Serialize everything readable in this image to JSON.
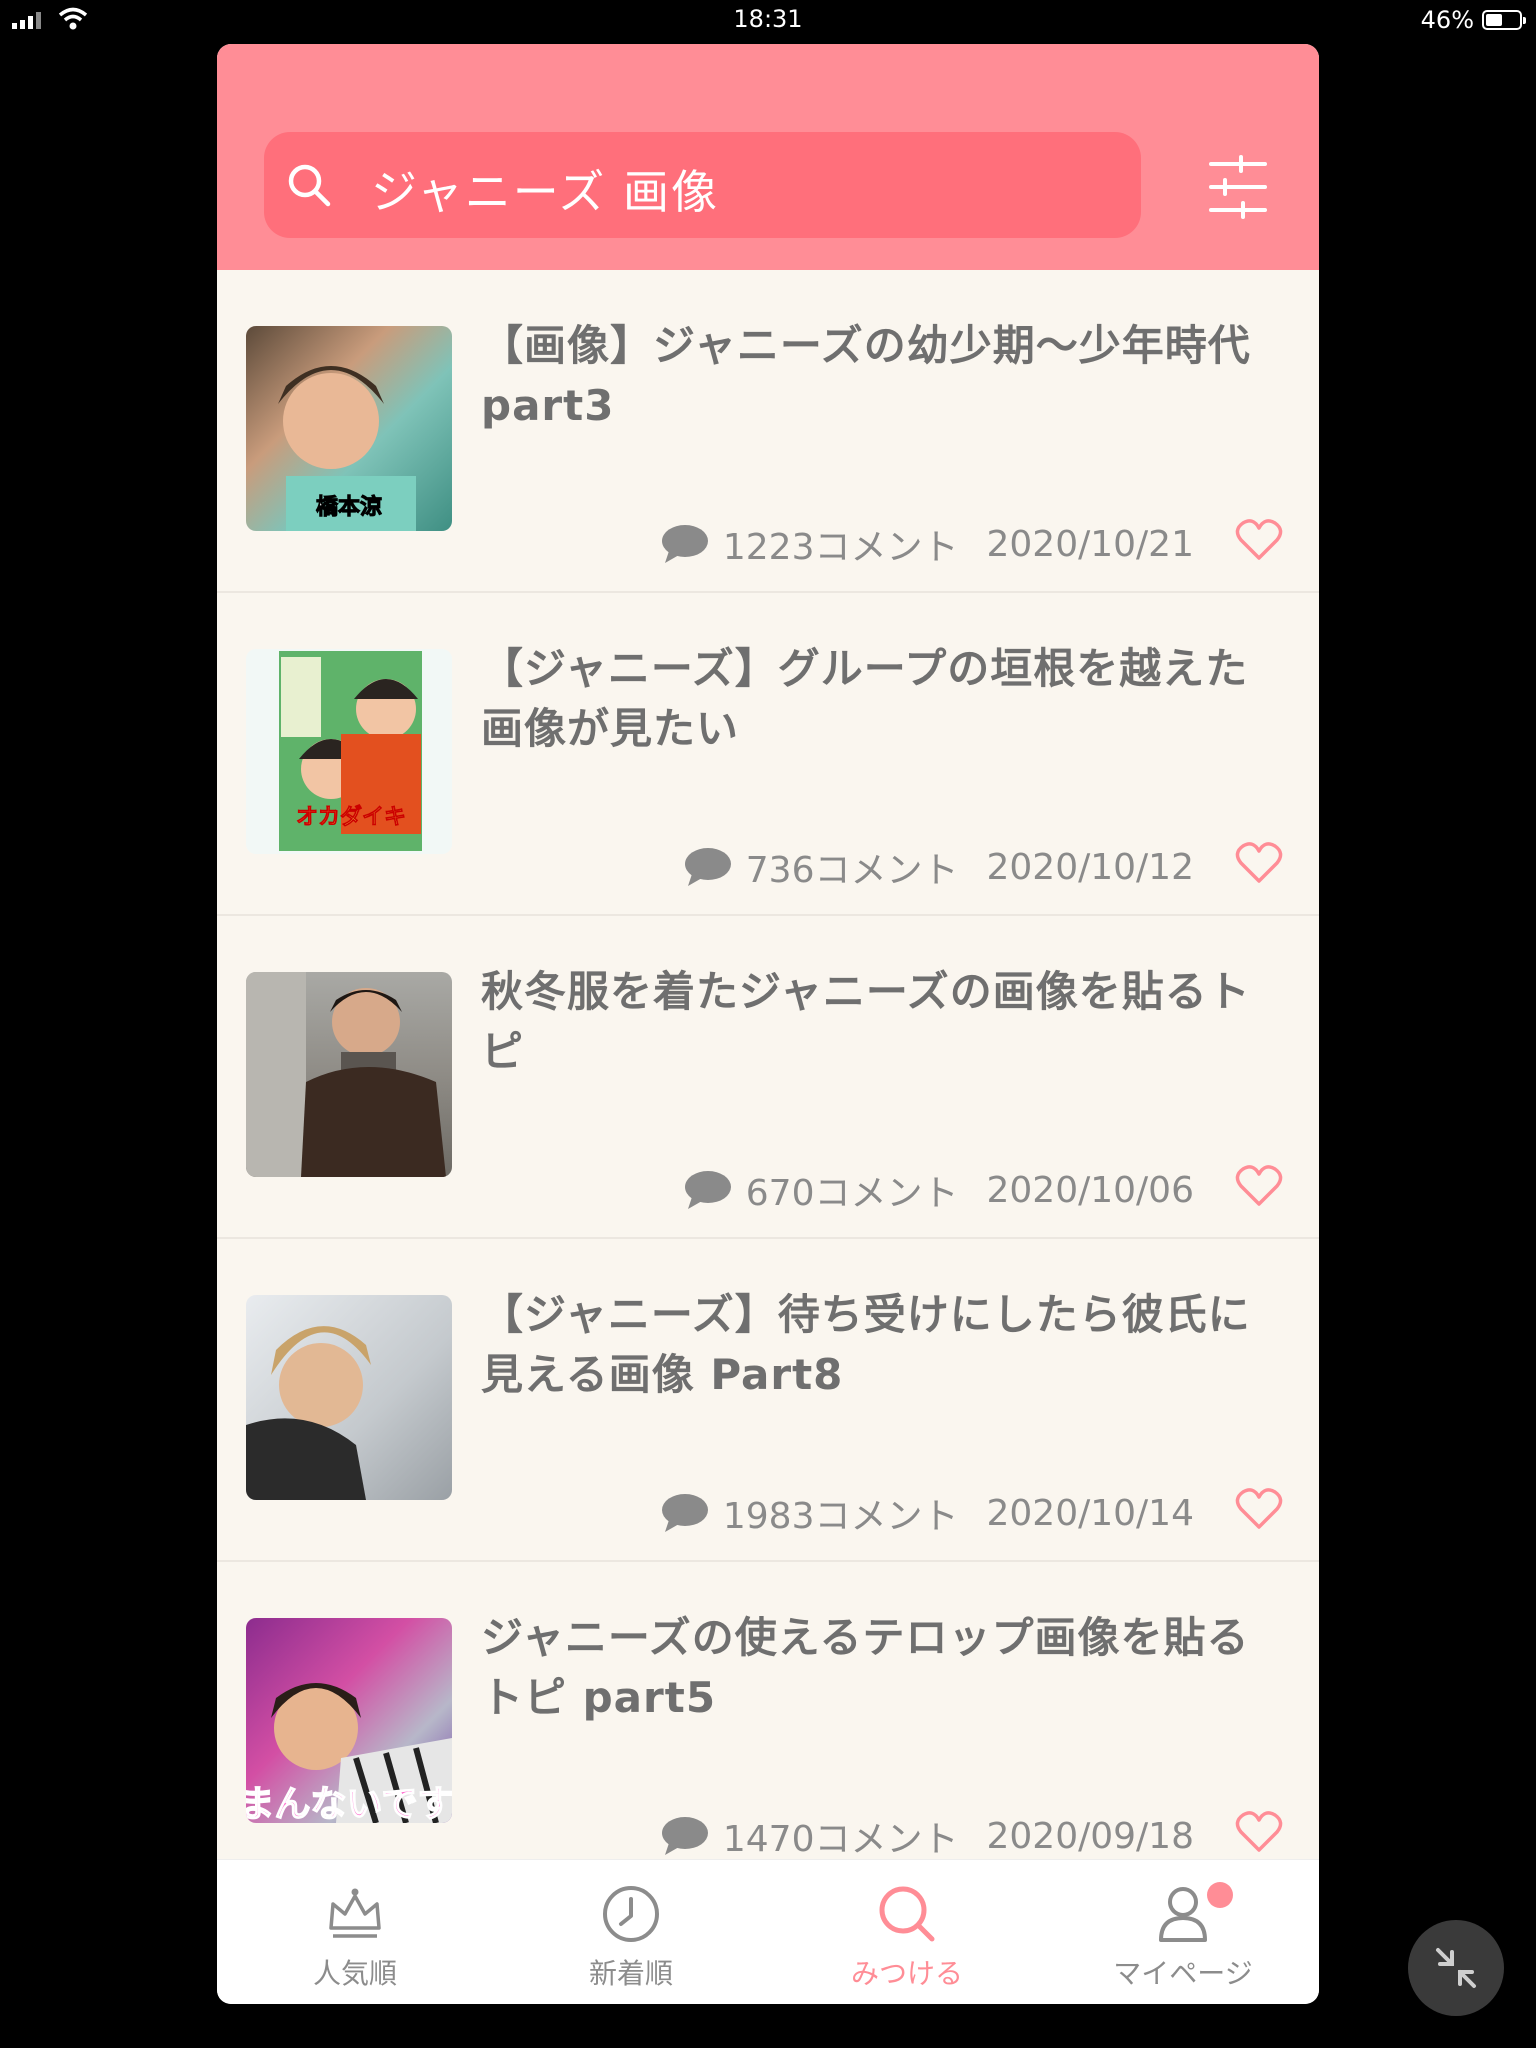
{
  "status_bar": {
    "time": "18:31",
    "battery": "46%"
  },
  "search": {
    "query": "ジャニーズ 画像"
  },
  "topics": [
    {
      "title": "【画像】ジャニーズの幼少期〜少年時代part3",
      "comments": "1223コメント",
      "date": "2020/10/21",
      "thumb_caption": "橋本涼"
    },
    {
      "title": "【ジャニーズ】グループの垣根を越えた画像が見たい",
      "comments": "736コメント",
      "date": "2020/10/12",
      "thumb_caption": "オカダイキ"
    },
    {
      "title": "秋冬服を着たジャニーズの画像を貼るトピ",
      "comments": "670コメント",
      "date": "2020/10/06",
      "thumb_caption": ""
    },
    {
      "title": "【ジャニーズ】待ち受けにしたら彼氏に見える画像 Part8",
      "comments": "1983コメント",
      "date": "2020/10/14",
      "thumb_caption": ""
    },
    {
      "title": "ジャニーズの使えるテロップ画像を貼るトピ part5",
      "comments": "1470コメント",
      "date": "2020/09/18",
      "thumb_caption": "まんないです"
    }
  ],
  "tabs": [
    {
      "label": "人気順",
      "icon": "crown-icon"
    },
    {
      "label": "新着順",
      "icon": "clock-icon"
    },
    {
      "label": "みつける",
      "icon": "search-icon",
      "active": true
    },
    {
      "label": "マイページ",
      "icon": "person-icon",
      "notification": true
    }
  ],
  "colors": {
    "brand": "#ff8d96",
    "search_bg": "#ff6f7b",
    "text": "#6f6f6f",
    "background": "#faf6ef"
  }
}
